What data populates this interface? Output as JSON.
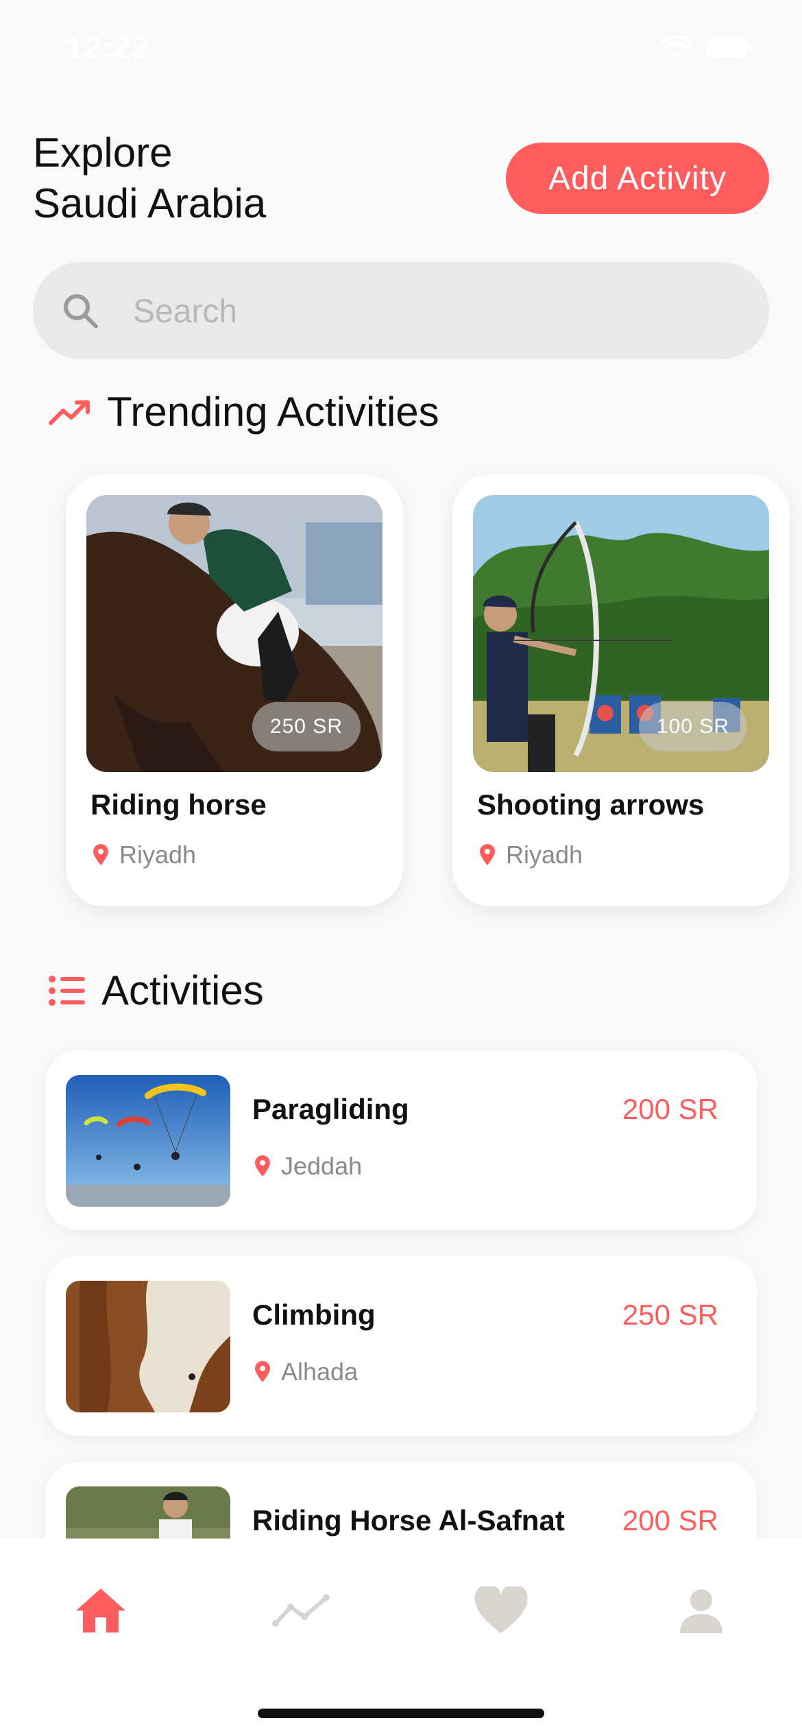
{
  "status_bar": {
    "time": "12:22"
  },
  "header": {
    "title": "Explore\nSaudi Arabia",
    "add_button": "Add Activity"
  },
  "search": {
    "placeholder": "Search",
    "value": ""
  },
  "trending": {
    "title": "Trending Activities",
    "items": [
      {
        "name": "Riding horse",
        "location": "Riyadh",
        "price": "250 SR"
      },
      {
        "name": "Shooting arrows",
        "location": "Riyadh",
        "price": "100 SR"
      }
    ]
  },
  "activities": {
    "title": "Activities",
    "items": [
      {
        "name": "Paragliding",
        "location": "Jeddah",
        "price": "200 SR"
      },
      {
        "name": "Climbing",
        "location": "Alhada",
        "price": "250 SR"
      },
      {
        "name": "Riding Horse Al-Safnat",
        "location": "",
        "price": "200 SR"
      }
    ]
  },
  "colors": {
    "accent": "#ff5d5d",
    "tab_inactive": "#d9d4ce",
    "background": "#f9f9f9"
  },
  "tab_bar": {
    "items": [
      "home-icon",
      "trend-icon",
      "heart-icon",
      "person-icon"
    ],
    "active": "home-icon"
  }
}
